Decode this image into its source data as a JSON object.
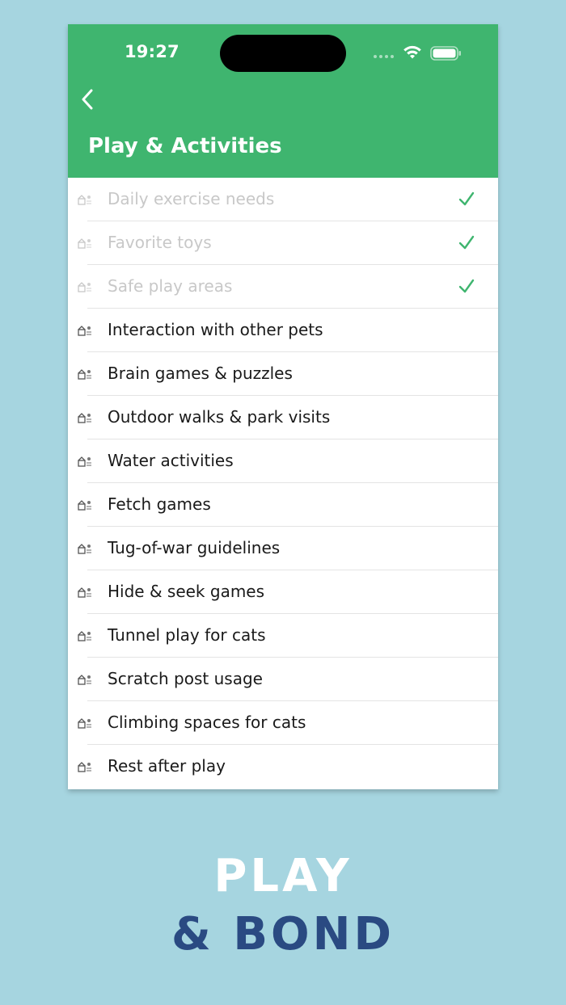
{
  "status_bar": {
    "time": "19:27"
  },
  "header": {
    "title": "Play & Activities",
    "back_icon": "chevron-left-icon"
  },
  "items": [
    {
      "label": "Daily exercise needs",
      "done": true
    },
    {
      "label": "Favorite toys",
      "done": true
    },
    {
      "label": "Safe play areas",
      "done": true
    },
    {
      "label": "Interaction with other pets",
      "done": false
    },
    {
      "label": "Brain games & puzzles",
      "done": false
    },
    {
      "label": "Outdoor walks & park visits",
      "done": false
    },
    {
      "label": "Water activities",
      "done": false
    },
    {
      "label": "Fetch games",
      "done": false
    },
    {
      "label": "Tug-of-war guidelines",
      "done": false
    },
    {
      "label": "Hide & seek games",
      "done": false
    },
    {
      "label": "Tunnel play for cats",
      "done": false
    },
    {
      "label": "Scratch post usage",
      "done": false
    },
    {
      "label": "Climbing spaces for cats",
      "done": false
    },
    {
      "label": "Rest after play",
      "done": false
    }
  ],
  "tagline": {
    "line1": "PLAY",
    "line2": "& BOND"
  },
  "colors": {
    "header_green": "#3fb56f",
    "check_green": "#3fb56f",
    "background": "#a6d5e0",
    "tagline_dark": "#2a4a82"
  }
}
